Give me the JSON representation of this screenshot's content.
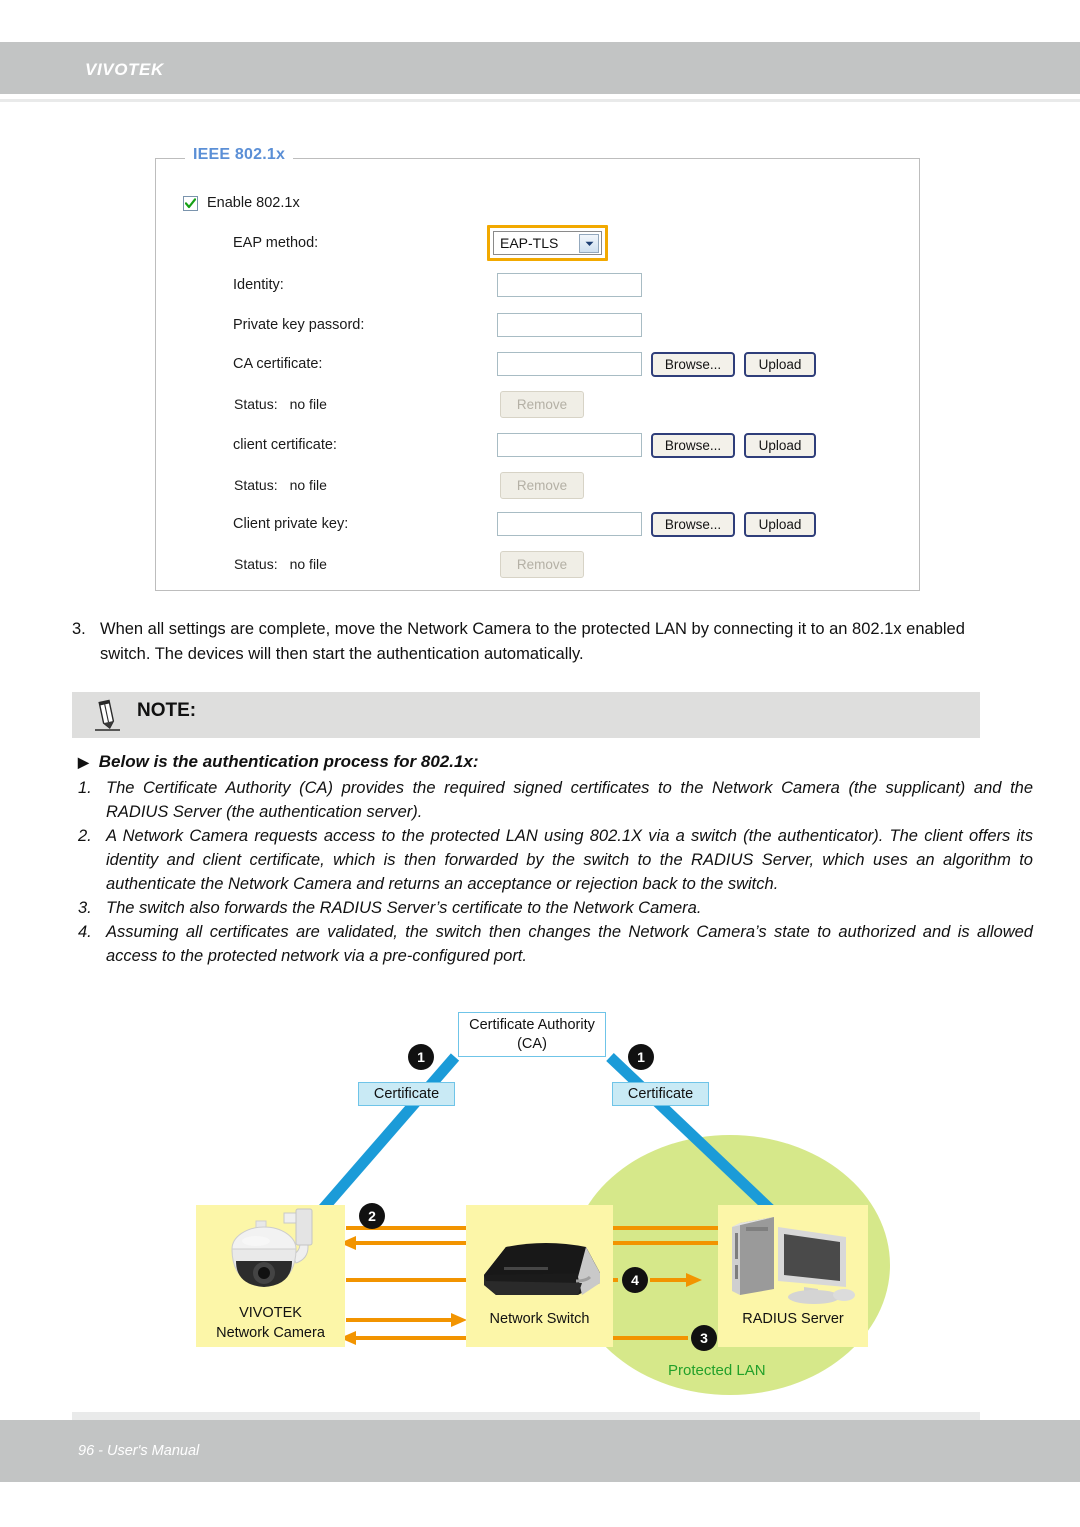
{
  "header": {
    "brand": "VIVOTEK"
  },
  "settings_panel": {
    "legend": "IEEE 802.1x",
    "enable_checkbox": {
      "label": "Enable 802.1x",
      "checked": true
    },
    "rows": [
      {
        "label": "EAP method:",
        "control": "select",
        "value": "EAP-TLS",
        "highlighted": true
      },
      {
        "label": "Identity:",
        "control": "text",
        "value": ""
      },
      {
        "label": "Private key passord:",
        "control": "text",
        "value": ""
      },
      {
        "label": "CA certificate:",
        "control": "file",
        "value": ""
      },
      {
        "label": "Status:",
        "control": "status",
        "value": "no file"
      },
      {
        "label": "client certificate:",
        "control": "file",
        "value": ""
      },
      {
        "label": "Status:",
        "control": "status",
        "value": "no file"
      },
      {
        "label": "Client private key:",
        "control": "file",
        "value": ""
      },
      {
        "label": "Status:",
        "control": "status",
        "value": "no file"
      }
    ],
    "buttons": {
      "browse": "Browse...",
      "upload": "Upload",
      "remove": "Remove"
    },
    "accent_highlight": "#f2a900",
    "legend_color": "#5b8fd6"
  },
  "body": {
    "step_number": "3.",
    "step_text": "When all settings are complete, move the Network Camera to the protected LAN by connecting it to an 802.1x enabled switch. The devices will then start the authentication automatically."
  },
  "note": {
    "title": "NOTE:",
    "lead_arrow": "▶",
    "lead": "Below is the authentication process for 802.1x:",
    "items": [
      {
        "n": "1.",
        "text": "The Certificate Authority (CA) provides the required signed certificates to the Network Camera (the supplicant) and the RADIUS Server (the authentication server)."
      },
      {
        "n": "2.",
        "text": "A Network Camera requests access to the protected LAN using 802.1X via a switch (the authenticator). The client offers its identity and client certificate, which is then forwarded by the switch to the RADIUS Server, which uses an algorithm to authenticate the Network Camera and returns an acceptance or rejection back to the switch."
      },
      {
        "n": "3.",
        "text": "The switch also forwards the RADIUS Server’s certificate to the Network Camera."
      },
      {
        "n": "4.",
        "text": "Assuming all certificates are validated, the switch then changes the Network Camera’s state to authorized and is allowed access to the protected network via a pre-configured port."
      }
    ]
  },
  "diagram": {
    "ca_box": {
      "line1": "Certificate Authority",
      "line2": "(CA)"
    },
    "cert_left": "Certificate",
    "cert_right": "Certificate",
    "badges": {
      "one_left": "1",
      "one_right": "1",
      "two": "2",
      "three": "3",
      "four": "4"
    },
    "camera": {
      "line1": "VIVOTEK",
      "line2": "Network Camera"
    },
    "switch": {
      "line1": "Network Switch"
    },
    "radius": {
      "line1": "RADIUS Server"
    },
    "lan_label": "Protected LAN",
    "colors": {
      "panel": "#fcf6a8",
      "lan": "#d6e88a",
      "lan_text": "#22a02a",
      "blue_arrow": "#1b9bd8",
      "orange_arrow": "#f29400",
      "cert_tag": "#c9eaf5"
    }
  },
  "footer": {
    "text": "96 - User's Manual"
  }
}
